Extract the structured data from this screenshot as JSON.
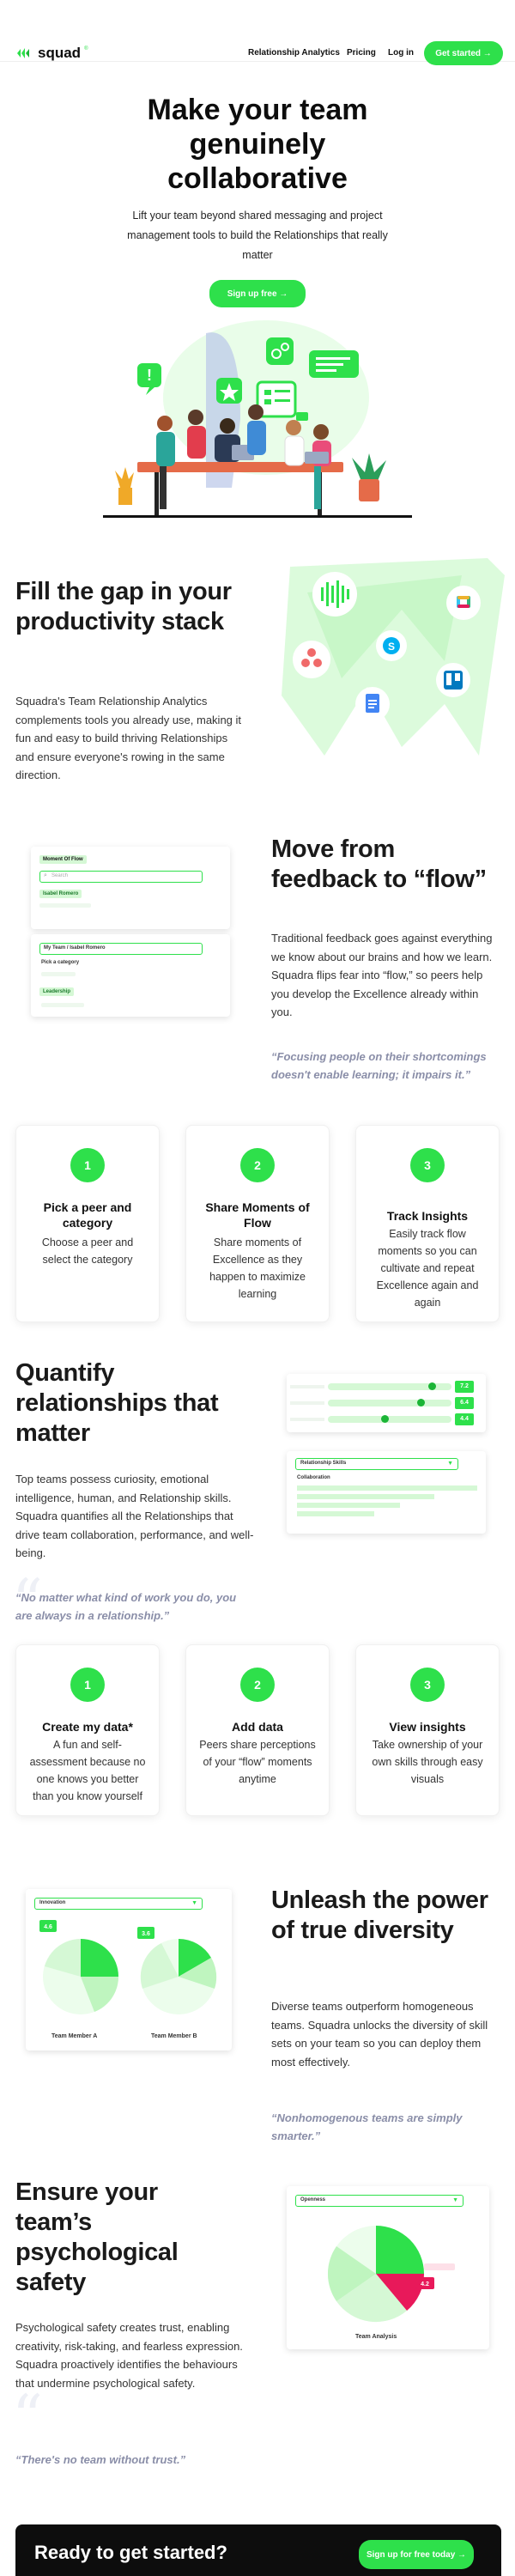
{
  "brand": {
    "name": "squad",
    "accent": "#2ee04b",
    "dark": "#0d0d0d"
  },
  "nav": {
    "links": [
      "Relationship Analytics",
      "Pricing",
      "Log in"
    ],
    "cta": "Get started →"
  },
  "hero": {
    "title": "Make your team genuinely collaborative",
    "subtitle": "Lift your team beyond shared messaging and project management tools to build the Relationships that really matter",
    "cta": "Sign up free →"
  },
  "gap": {
    "title": "Fill the gap in your productivity stack",
    "body": "Squadra's Team Relationship Analytics complements tools you already use, making it fun and easy to build thriving Relationships and ensure everyone's rowing in the same direction.",
    "integrations": [
      "waveform-icon",
      "slack-icon",
      "asana-icon",
      "skype-icon",
      "trello-icon",
      "docs-icon"
    ]
  },
  "feedback": {
    "title": "Move from feedback to “flow”",
    "body": "Traditional feedback goes against everything we know about our brains and how we learn. Squadra flips fear into “flow,” so peers help you develop the Excellence already within you.",
    "quote": "“Focusing people on their shortcomings doesn't enable learning; it impairs it.”",
    "mock": {
      "panel1_title": "Moment Of Flow",
      "search_placeholder": "Search",
      "selected": "Isabel Romero",
      "panel2_path": "My Team / Isabel Romero",
      "pick_label": "Pick a category",
      "category": "Leadership"
    },
    "steps": [
      {
        "num": "1",
        "title": "Pick a peer and category",
        "desc": "Choose a peer and select the category"
      },
      {
        "num": "2",
        "title": "Share Moments of Flow",
        "desc": "Share moments of Excellence as they happen to maximize learning"
      },
      {
        "num": "3",
        "title": "Track Insights",
        "desc": "Easily track flow moments so you can cultivate and repeat Excellence again and again"
      }
    ]
  },
  "quantify": {
    "title": "Quantify relationships that matter",
    "body": "Top teams possess curiosity, emotional intelligence, human, and Relationship skills. Squadra quantifies all the Relationships that drive team collaboration, performance, and well-being.",
    "quote": "“No matter what kind of work you do, you are always in a relationship.”",
    "mock": {
      "sliders": [
        {
          "value": "7.2",
          "level": 0.72
        },
        {
          "value": "6.4",
          "level": 0.64
        },
        {
          "value": "4.4",
          "level": 0.44
        }
      ],
      "dropdown": "Relationship Skills",
      "section": "Collaboration"
    },
    "steps": [
      {
        "num": "1",
        "title": "Create my data*",
        "desc": "A fun and self-assessment because no one knows you better than you know yourself"
      },
      {
        "num": "2",
        "title": "Add data",
        "desc": "Peers share perceptions of your “flow” moments anytime"
      },
      {
        "num": "3",
        "title": "View insights",
        "desc": "Take ownership of your own skills through easy visuals"
      }
    ]
  },
  "diversity": {
    "title": "Unleash the power of true diversity",
    "body": "Diverse teams outperform homogeneous teams. Squadra unlocks the diversity of skill sets on your team so you can deploy them most effectively.",
    "quote": "“Nonhomogenous teams are simply smarter.”",
    "mock": {
      "dropdown": "Innovation",
      "member_a": "Team Member A",
      "member_b": "Team Member B",
      "score_a": "4.6",
      "score_b": "3.6"
    }
  },
  "safety": {
    "title": "Ensure your team’s psychological safety",
    "body": "Psychological safety creates trust, enabling creativity, risk-taking, and fearless expression. Squadra proactively identifies the behaviours that undermine psychological safety.",
    "quote": "“There's no team without trust.”",
    "mock": {
      "dropdown": "Openness",
      "label": "Team Analysis",
      "score": "4.2"
    }
  },
  "footer_cta": {
    "title": "Ready to get started?",
    "cta": "Sign up for free today →"
  }
}
